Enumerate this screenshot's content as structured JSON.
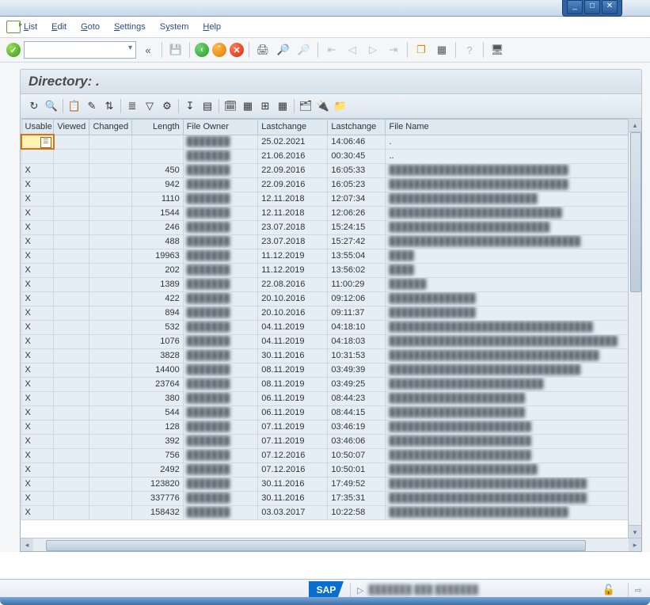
{
  "window_controls": {
    "min": "_",
    "max": "□",
    "close": "✕"
  },
  "menu": {
    "list": "List",
    "edit": "Edit",
    "goto": "Goto",
    "settings": "Settings",
    "system": "System",
    "help": "Help"
  },
  "toolbar": {
    "back_tip": "«",
    "save": "💾",
    "nav_back": "‹",
    "nav_up": "^",
    "nav_cancel": "✕",
    "print": "🖨",
    "find": "🔍",
    "first": "⇤",
    "prev": "◁",
    "next": "▷",
    "last": "⇥",
    "new_session": "❐",
    "layout": "▦",
    "help": "?",
    "shortcut": "⌨"
  },
  "title": "Directory: .",
  "listbar_icons": [
    "↻",
    "🔍",
    "📋",
    "✎",
    "⇅",
    "≣",
    "▽",
    "⚙",
    "↧",
    "▤",
    "🗓",
    "▦",
    "⊞",
    "▦",
    "🗂",
    "🔌",
    "📁"
  ],
  "columns": {
    "usable": "Usable",
    "viewed": "Viewed",
    "changed": "Changed",
    "length": "Length",
    "owner": "File Owner",
    "date": "Lastchange",
    "time": "Lastchange",
    "name": "File Name"
  },
  "colwidths": {
    "usable": 38,
    "viewed": 42,
    "changed": 50,
    "length": 60,
    "owner": 88,
    "date": 82,
    "time": 68,
    "name": 300
  },
  "rows": [
    {
      "usable": "",
      "viewed": "",
      "changed": "",
      "length": "",
      "owner": "███████",
      "date": "25.02.2021",
      "time": "14:06:46",
      "name": "."
    },
    {
      "usable": "",
      "viewed": "",
      "changed": "",
      "length": "",
      "owner": "███████",
      "date": "21.06.2016",
      "time": "00:30:45",
      "name": ".."
    },
    {
      "usable": "X",
      "viewed": "",
      "changed": "",
      "length": "450",
      "owner": "███████",
      "date": "22.09.2016",
      "time": "16:05:33",
      "name": "█████████████████████████████"
    },
    {
      "usable": "X",
      "viewed": "",
      "changed": "",
      "length": "942",
      "owner": "███████",
      "date": "22.09.2016",
      "time": "16:05:23",
      "name": "█████████████████████████████"
    },
    {
      "usable": "X",
      "viewed": "",
      "changed": "",
      "length": "1110",
      "owner": "███████",
      "date": "12.11.2018",
      "time": "12:07:34",
      "name": "████████████████████████"
    },
    {
      "usable": "X",
      "viewed": "",
      "changed": "",
      "length": "1544",
      "owner": "███████",
      "date": "12.11.2018",
      "time": "12:06:26",
      "name": "████████████████████████████"
    },
    {
      "usable": "X",
      "viewed": "",
      "changed": "",
      "length": "246",
      "owner": "███████",
      "date": "23.07.2018",
      "time": "15:24:15",
      "name": "██████████████████████████"
    },
    {
      "usable": "X",
      "viewed": "",
      "changed": "",
      "length": "488",
      "owner": "███████",
      "date": "23.07.2018",
      "time": "15:27:42",
      "name": "███████████████████████████████"
    },
    {
      "usable": "X",
      "viewed": "",
      "changed": "",
      "length": "19963",
      "owner": "███████",
      "date": "11.12.2019",
      "time": "13:55:04",
      "name": "████"
    },
    {
      "usable": "X",
      "viewed": "",
      "changed": "",
      "length": "202",
      "owner": "███████",
      "date": "11.12.2019",
      "time": "13:56:02",
      "name": "████"
    },
    {
      "usable": "X",
      "viewed": "",
      "changed": "",
      "length": "1389",
      "owner": "███████",
      "date": "22.08.2016",
      "time": "11:00:29",
      "name": "██████"
    },
    {
      "usable": "X",
      "viewed": "",
      "changed": "",
      "length": "422",
      "owner": "███████",
      "date": "20.10.2016",
      "time": "09:12:06",
      "name": "██████████████"
    },
    {
      "usable": "X",
      "viewed": "",
      "changed": "",
      "length": "894",
      "owner": "███████",
      "date": "20.10.2016",
      "time": "09:11:37",
      "name": "██████████████"
    },
    {
      "usable": "X",
      "viewed": "",
      "changed": "",
      "length": "532",
      "owner": "███████",
      "date": "04.11.2019",
      "time": "04:18:10",
      "name": "█████████████████████████████████"
    },
    {
      "usable": "X",
      "viewed": "",
      "changed": "",
      "length": "1076",
      "owner": "███████",
      "date": "04.11.2019",
      "time": "04:18:03",
      "name": "█████████████████████████████████████"
    },
    {
      "usable": "X",
      "viewed": "",
      "changed": "",
      "length": "3828",
      "owner": "███████",
      "date": "30.11.2016",
      "time": "10:31:53",
      "name": "██████████████████████████████████"
    },
    {
      "usable": "X",
      "viewed": "",
      "changed": "",
      "length": "14400",
      "owner": "███████",
      "date": "08.11.2019",
      "time": "03:49:39",
      "name": "███████████████████████████████"
    },
    {
      "usable": "X",
      "viewed": "",
      "changed": "",
      "length": "23764",
      "owner": "███████",
      "date": "08.11.2019",
      "time": "03:49:25",
      "name": "█████████████████████████"
    },
    {
      "usable": "X",
      "viewed": "",
      "changed": "",
      "length": "380",
      "owner": "███████",
      "date": "06.11.2019",
      "time": "08:44:23",
      "name": "██████████████████████"
    },
    {
      "usable": "X",
      "viewed": "",
      "changed": "",
      "length": "544",
      "owner": "███████",
      "date": "06.11.2019",
      "time": "08:44:15",
      "name": "██████████████████████"
    },
    {
      "usable": "X",
      "viewed": "",
      "changed": "",
      "length": "128",
      "owner": "███████",
      "date": "07.11.2019",
      "time": "03:46:19",
      "name": "███████████████████████"
    },
    {
      "usable": "X",
      "viewed": "",
      "changed": "",
      "length": "392",
      "owner": "███████",
      "date": "07.11.2019",
      "time": "03:46:06",
      "name": "███████████████████████"
    },
    {
      "usable": "X",
      "viewed": "",
      "changed": "",
      "length": "756",
      "owner": "███████",
      "date": "07.12.2016",
      "time": "10:50:07",
      "name": "███████████████████████"
    },
    {
      "usable": "X",
      "viewed": "",
      "changed": "",
      "length": "2492",
      "owner": "███████",
      "date": "07.12.2016",
      "time": "10:50:01",
      "name": "████████████████████████"
    },
    {
      "usable": "X",
      "viewed": "",
      "changed": "",
      "length": "123820",
      "owner": "███████",
      "date": "30.11.2016",
      "time": "17:49:52",
      "name": "████████████████████████████████"
    },
    {
      "usable": "X",
      "viewed": "",
      "changed": "",
      "length": "337776",
      "owner": "███████",
      "date": "30.11.2016",
      "time": "17:35:31",
      "name": "████████████████████████████████"
    },
    {
      "usable": "X",
      "viewed": "",
      "changed": "",
      "length": "158432",
      "owner": "███████",
      "date": "03.03.2017",
      "time": "10:22:58",
      "name": "█████████████████████████████"
    }
  ],
  "status": {
    "sap": "SAP",
    "tri": "▷",
    "text": "███████   ███   ███████",
    "lock": "🔒",
    "last": "⇨"
  }
}
